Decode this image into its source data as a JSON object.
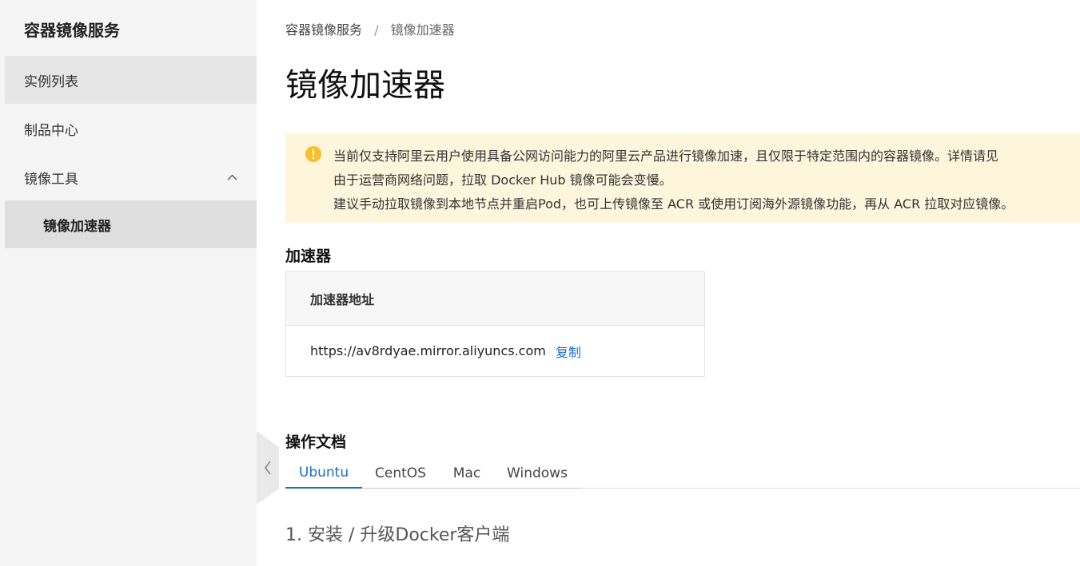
{
  "sidebar": {
    "title": "容器镜像服务",
    "items": [
      {
        "label": "实例列表"
      },
      {
        "label": "制品中心"
      },
      {
        "label": "镜像工具"
      },
      {
        "label": "镜像加速器"
      }
    ]
  },
  "breadcrumb": {
    "root": "容器镜像服务",
    "separator": "/",
    "current": "镜像加速器"
  },
  "page": {
    "title": "镜像加速器"
  },
  "notice": {
    "lines": [
      "当前仅支持阿里云用户使用具备公网访问能力的阿里云产品进行镜像加速，且仅限于特定范围内的容器镜像。详情请见",
      "由于运营商网络问题，拉取 Docker Hub 镜像可能会变慢。",
      "建议手动拉取镜像到本地节点并重启Pod，也可上传镜像至 ACR 或使用订阅海外源镜像功能，再从 ACR 拉取对应镜像。"
    ]
  },
  "accelerator": {
    "section_title": "加速器",
    "header": "加速器地址",
    "address": "https://av8rdyae.mirror.aliyuncs.com",
    "copy_label": "复制"
  },
  "docs": {
    "section_title": "操作文档",
    "tabs": [
      {
        "label": "Ubuntu",
        "active": true
      },
      {
        "label": "CentOS",
        "active": false
      },
      {
        "label": "Mac",
        "active": false
      },
      {
        "label": "Windows",
        "active": false
      }
    ],
    "step_title": "1. 安装 / 升级Docker客户端"
  },
  "icons": {
    "warning": "warning-circle-icon",
    "chevron_up": "chevron-up-icon",
    "collapse": "chevron-left-icon"
  },
  "colors": {
    "accent": "#1a6fc4",
    "notice_bg": "#fdf6dc",
    "warning": "#f7c02b",
    "sidebar_bg": "#f5f5f5"
  }
}
